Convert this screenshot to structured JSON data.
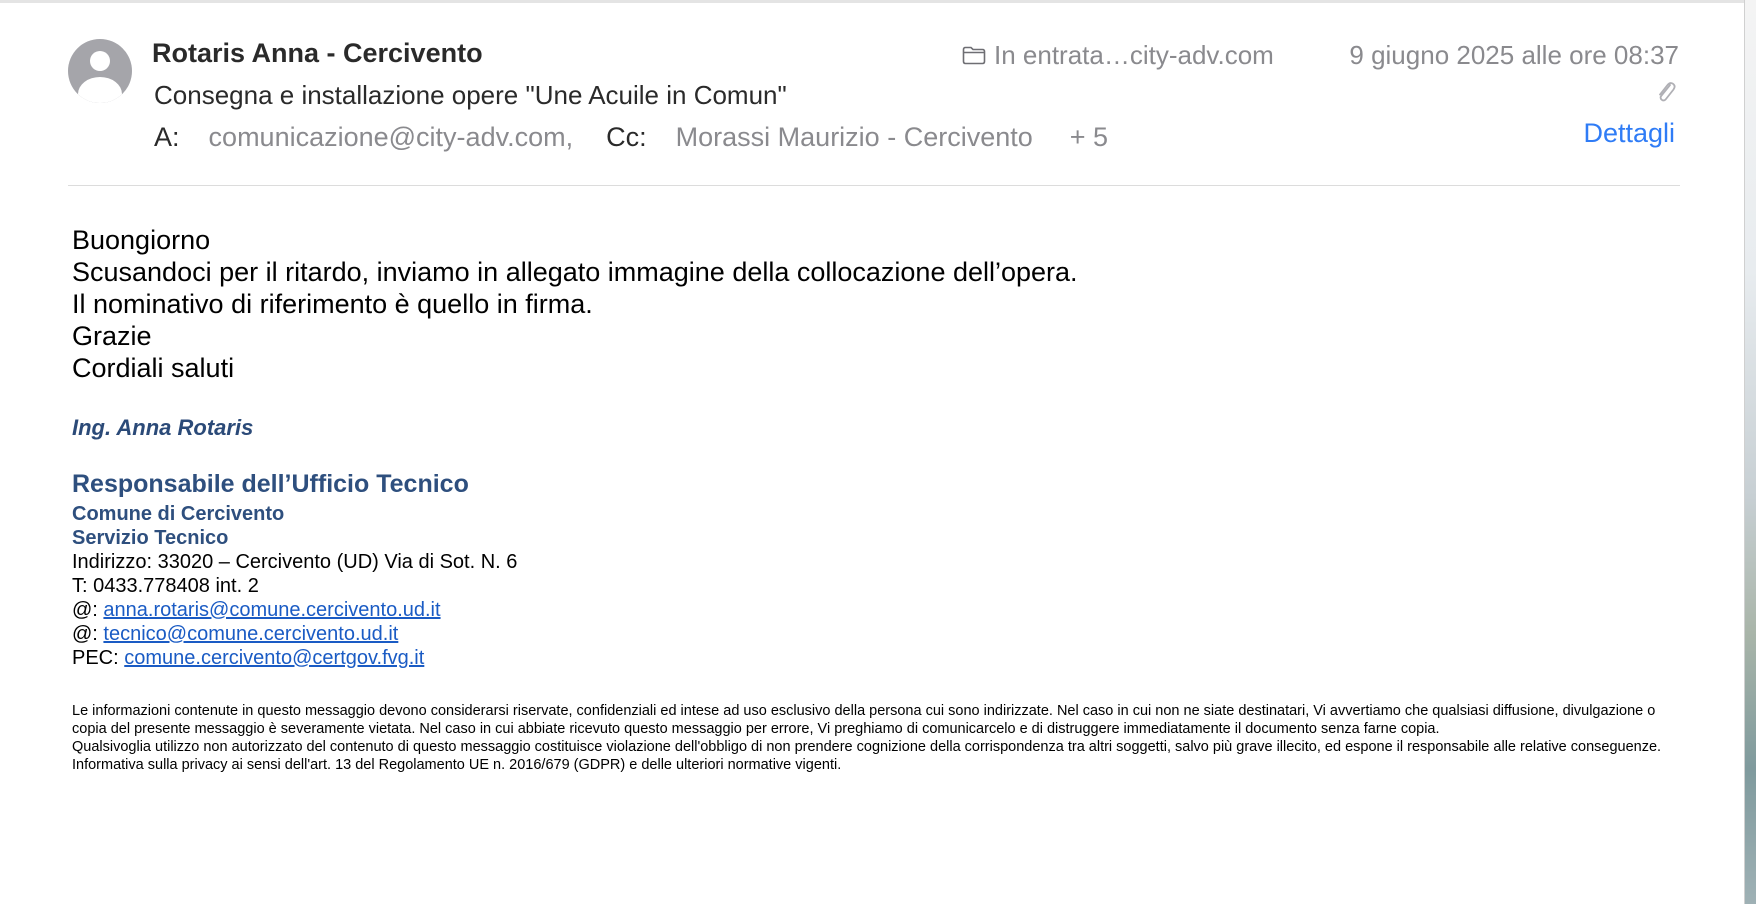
{
  "header": {
    "sender": "Rotaris Anna - Cercivento",
    "subject": "Consegna e installazione opere \"Une Acuile in Comun\"",
    "to_label": "A:",
    "to_value": "comunicazione@city-adv.com,",
    "cc_label": "Cc:",
    "cc_value": "Morassi Maurizio - Cercivento",
    "more_recipients": "+ 5",
    "mailbox": "In entrata…city-adv.com",
    "date": "9 giugno 2025 alle ore 08:37",
    "details_label": "Dettagli",
    "icons": {
      "avatar": "avatar-icon",
      "folder": "folder-icon",
      "attachment": "paperclip-icon"
    }
  },
  "body": {
    "lines": [
      "Buongiorno",
      "Scusandoci per il ritardo, inviamo in allegato immagine della collocazione dell’opera.",
      "Il nominativo di riferimento è quello in firma.",
      "Grazie",
      "Cordiali saluti"
    ]
  },
  "signature": {
    "name": "Ing. Anna Rotaris",
    "role": "Responsabile dell’Ufficio Tecnico",
    "org": "Comune di Cercivento",
    "service": "Servizio Tecnico",
    "address": "Indirizzo: 33020 – Cercivento (UD) Via di Sot. N. 6",
    "phone": "T: 0433.778408 int. 2",
    "email1_prefix": "@: ",
    "email1": "anna.rotaris@comune.cercivento.ud.it",
    "email2_prefix": "@: ",
    "email2": "tecnico@comune.cercivento.ud.it",
    "pec_prefix": "PEC: ",
    "pec": "comune.cercivento@certgov.fvg.it"
  },
  "disclaimer": {
    "p1": "Le informazioni contenute in questo messaggio devono considerarsi riservate, confidenziali ed intese ad uso esclusivo della persona cui sono indirizzate. Nel caso in cui non ne siate destinatari, Vi avvertiamo che qualsiasi diffusione, divulgazione o copia del presente messaggio è severamente vietata. Nel caso in cui abbiate ricevuto questo messaggio per errore, Vi preghiamo di comunicarcelo e di distruggere immediatamente il  documento senza farne copia.",
    "p2": "Qualsivoglia utilizzo non autorizzato del contenuto di questo messaggio costituisce violazione dell'obbligo di non prendere cognizione della corrispondenza tra altri soggetti, salvo più grave illecito, ed espone il responsabile alle relative conseguenze.",
    "p3": "Informativa sulla privacy ai sensi dell'art. 13 del Regolamento UE n. 2016/679 (GDPR) e delle ulteriori normative vigenti."
  },
  "colors": {
    "link": "#1a5bc4",
    "accent": "#2f7cf6",
    "signature": "#2e4f7e",
    "muted": "#8a8a8e"
  }
}
